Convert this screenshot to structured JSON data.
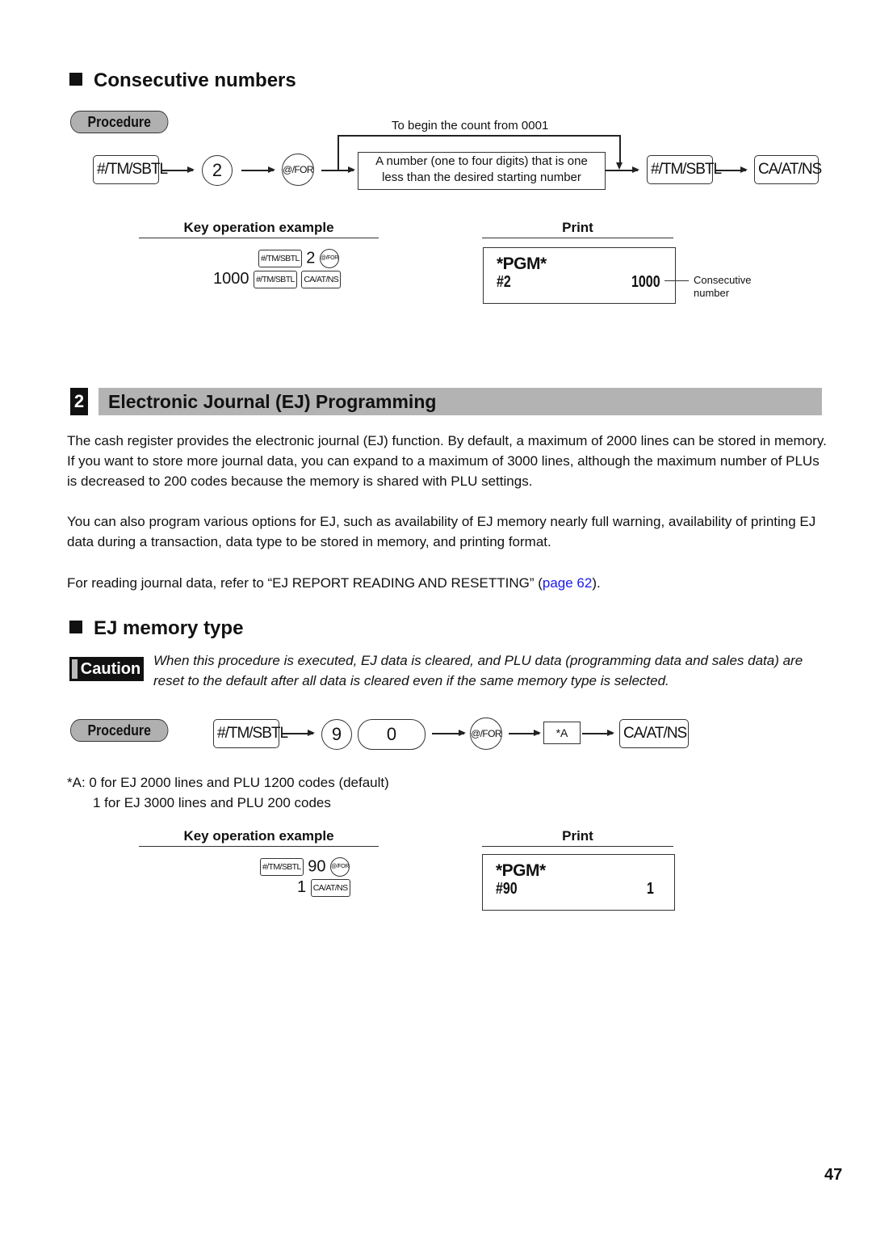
{
  "consecutive": {
    "heading": "Consecutive numbers",
    "procedure_label": "Procedure",
    "keys": {
      "tm_sbtl": "#/TM/SBTL",
      "digit_2": "2",
      "at_for": "@/FOR",
      "ca_at_ns": "CA/AT/NS"
    },
    "bypass_note": "To begin the count from 0001",
    "number_box_line1": "A number (one to four digits) that is one",
    "number_box_line2": "less than the desired starting number",
    "key_example_heading": "Key operation example",
    "key_example": {
      "line1_value": "2",
      "line2_value": "1000"
    },
    "print_heading": "Print",
    "print": {
      "header": "*PGM*",
      "left": "#2",
      "right": "1000"
    },
    "callout_line1": "Consecutive",
    "callout_line2": "number"
  },
  "section2": {
    "number": "2",
    "title": "Electronic Journal (EJ) Programming",
    "para1": "The cash register provides the electronic journal (EJ) function.  By default, a maximum of 2000 lines can be stored in memory.  If you want to store more journal data, you can expand to a maximum of 3000 lines, although the maximum number of PLUs is decreased to 200 codes because the memory is shared with PLU settings.",
    "para2": "You can also program various options for EJ, such as availability of EJ memory nearly full warning, availability of printing EJ data during a transaction, data type to be stored in memory, and printing format.",
    "para3_prefix": "For reading journal data, refer to “EJ REPORT READING AND RESETTING” (",
    "para3_link": "page 62",
    "para3_suffix": ").",
    "link_color": "#1a1aee"
  },
  "ej_memory": {
    "heading": "EJ memory type",
    "caution_label": "Caution",
    "caution_text": "When this procedure is executed, EJ data is cleared, and PLU data (programming data and sales data) are reset to the default after all data is cleared even if the same memory type is selected.",
    "procedure_label": "Procedure",
    "keys": {
      "tm_sbtl": "#/TM/SBTL",
      "digit_9": "9",
      "digit_0": "0",
      "at_for": "@/FOR",
      "var_a": "*A",
      "ca_at_ns": "CA/AT/NS"
    },
    "note_line1": "*A: 0 for EJ 2000 lines and PLU 1200 codes (default)",
    "note_line2": "1 for EJ 3000 lines and PLU 200 codes",
    "key_example_heading": "Key operation example",
    "key_example": {
      "line1_value": "90",
      "line2_value": "1"
    },
    "print_heading": "Print",
    "print": {
      "header": "*PGM*",
      "left": "#90",
      "right": "1"
    }
  },
  "page_number": "47"
}
